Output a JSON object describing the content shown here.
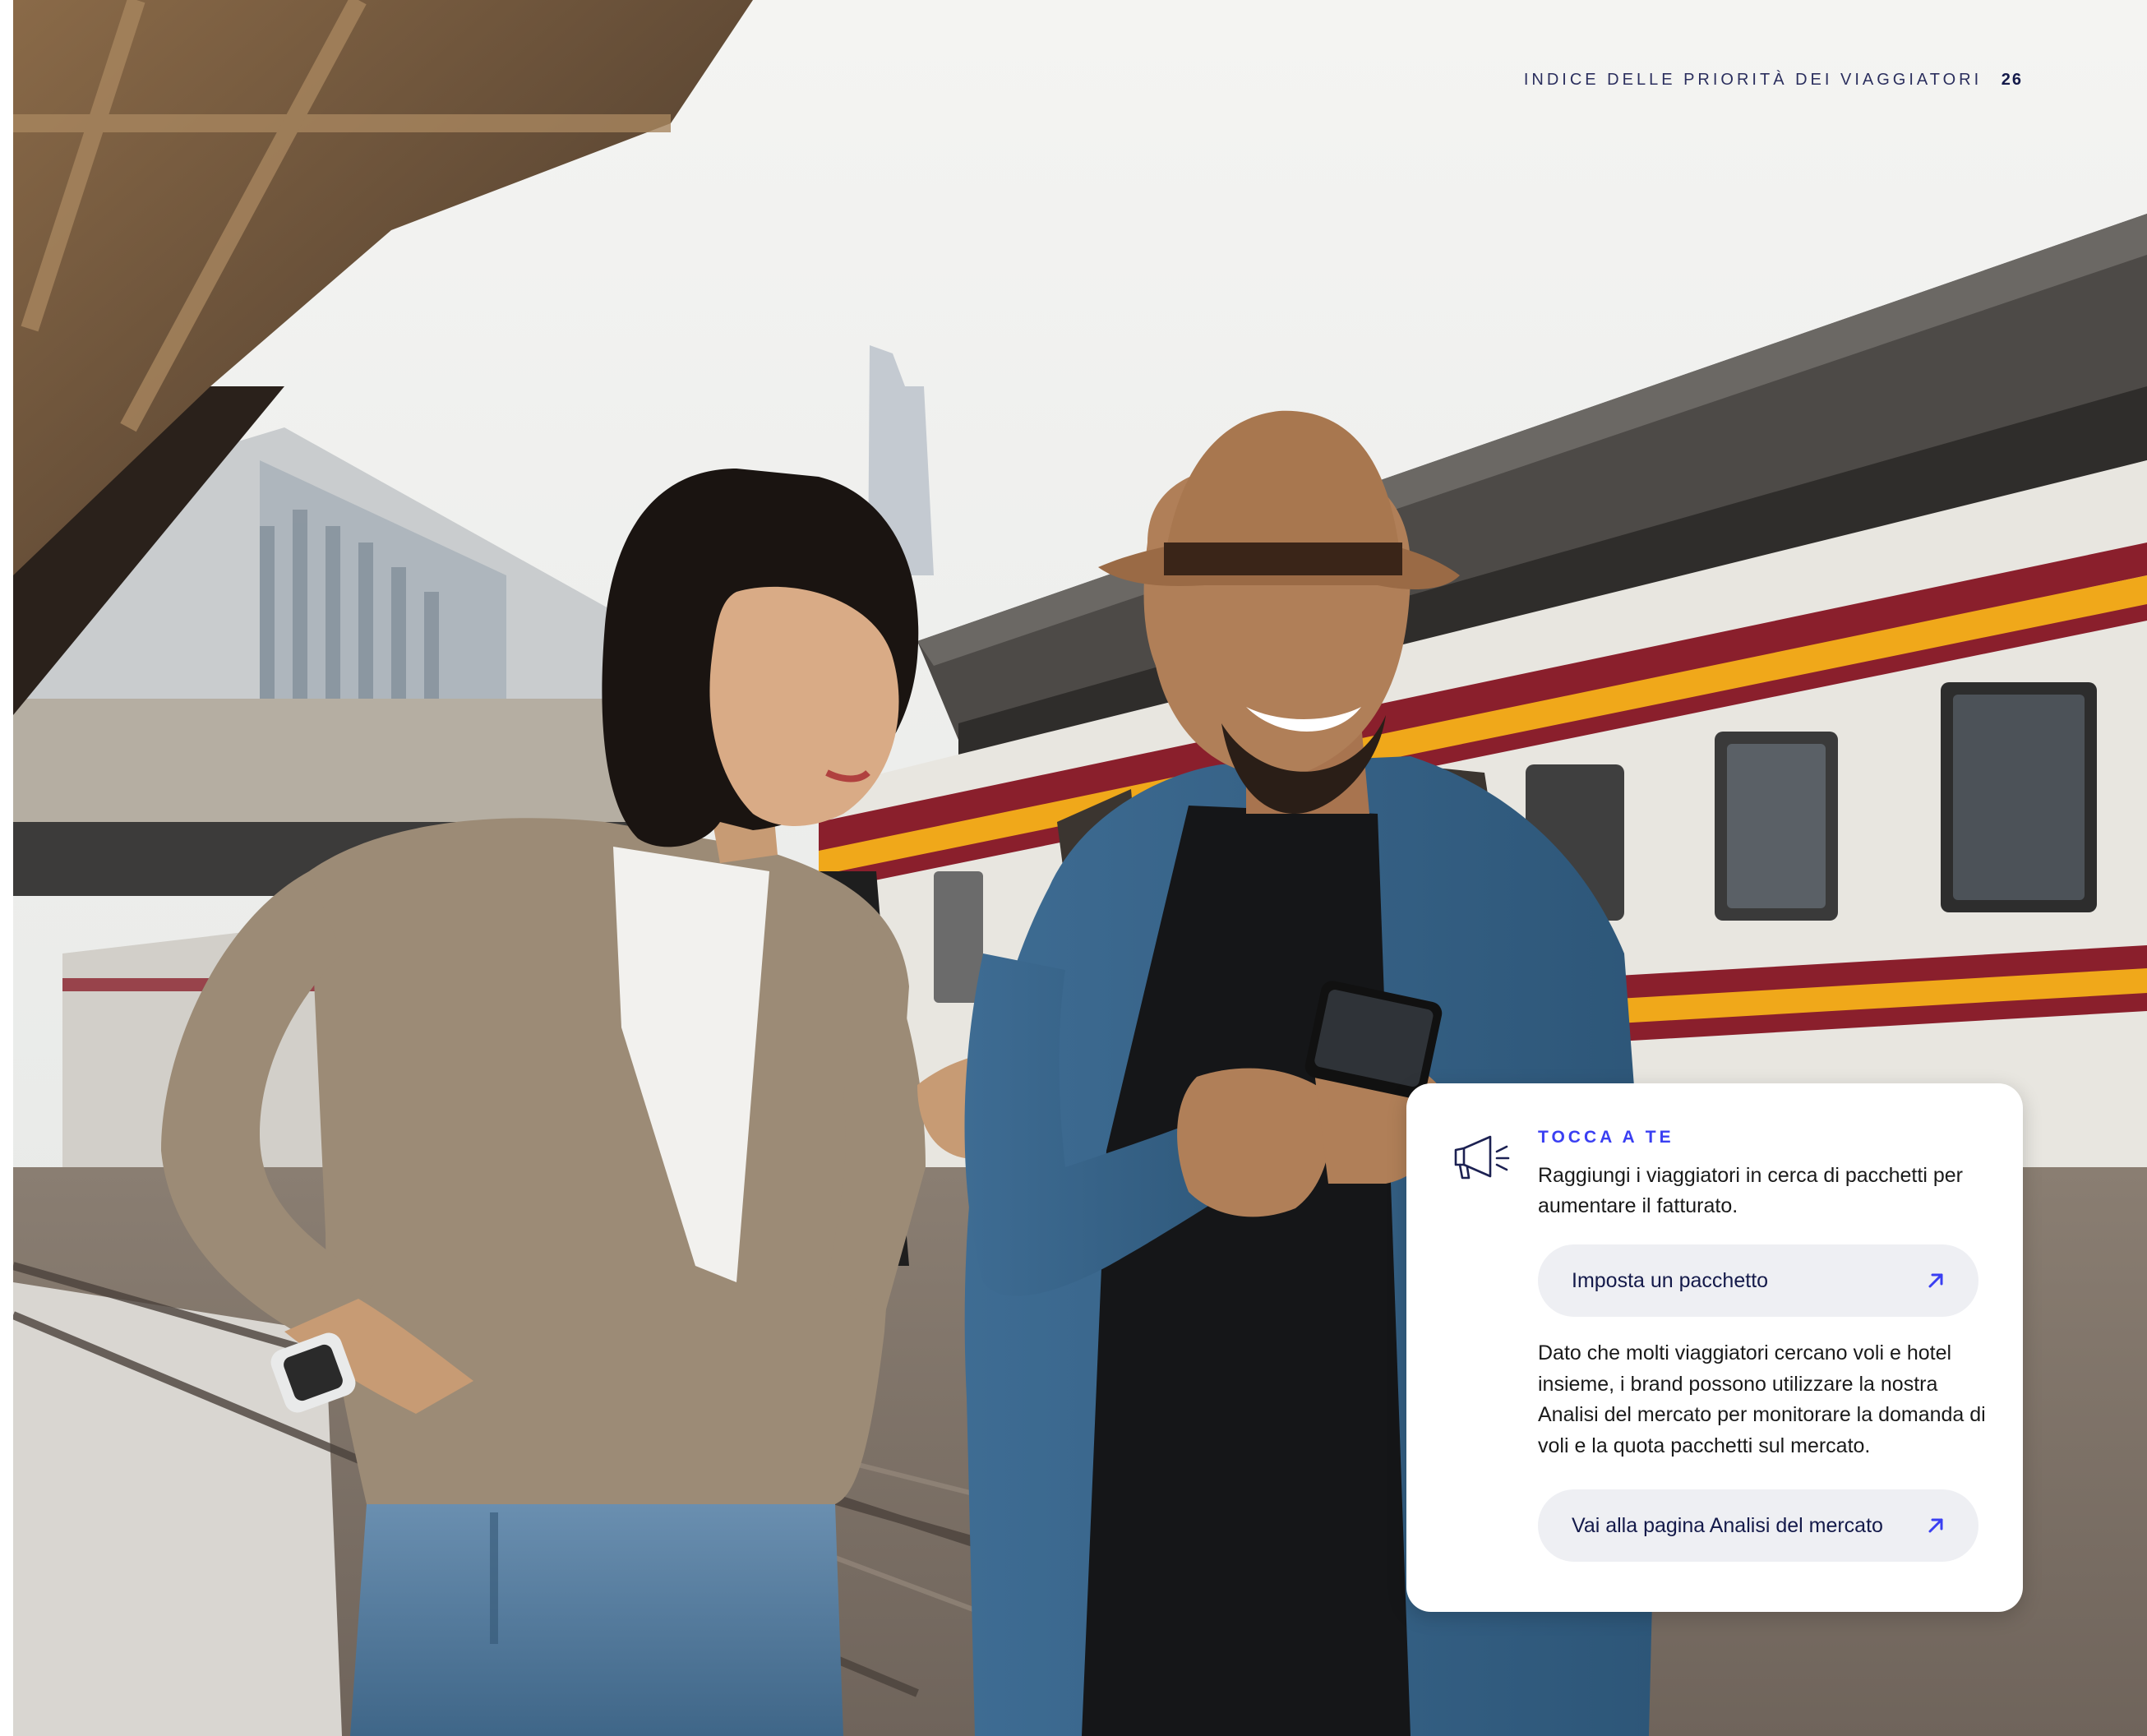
{
  "header": {
    "title": "INDICE DELLE PRIORITÀ DEI VIAGGIATORI",
    "page_number": "26"
  },
  "photo": {
    "icon": "photo-travelers-train-platform"
  },
  "card": {
    "icon": "megaphone-icon",
    "kicker": "TOCCA A TE",
    "lead": "Raggiungi i viaggiatori in cerca di pacchetti per aumentare il fatturato.",
    "cta_primary": {
      "label": "Imposta un pacchetto",
      "icon": "arrow-up-right-icon"
    },
    "body": "Dato che molti viaggiatori cercano voli e hotel insieme, i brand possono utilizzare la nostra Analisi del mercato per monitorare la domanda di voli e la quota pacchetti sul mercato.",
    "cta_secondary": {
      "label": "Vai alla pagina Analisi del mercato",
      "icon": "arrow-up-right-icon"
    }
  },
  "colors": {
    "accent": "#3a3ff2",
    "navy": "#141a4a",
    "button_bg": "#eeeff3",
    "train_red": "#8a1f2c",
    "train_yellow": "#f0a81a"
  }
}
